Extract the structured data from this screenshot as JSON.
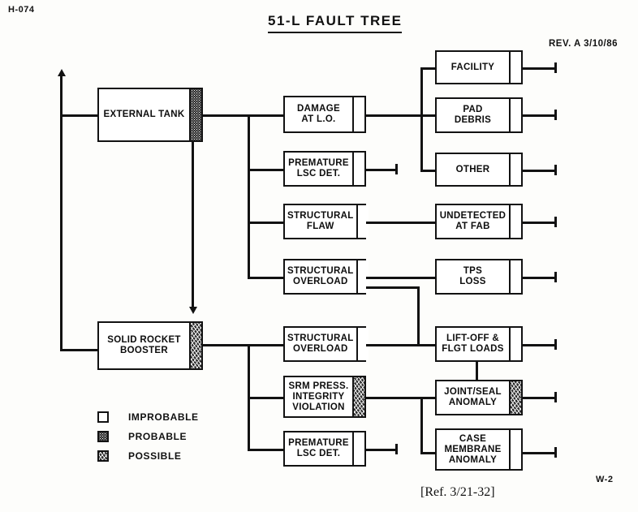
{
  "meta": {
    "doc_id": "H-074",
    "title": "51-L FAULT TREE",
    "revision": "REV. A 3/10/86",
    "sheet_id": "W-2",
    "reference": "[Ref. 3/21-32]"
  },
  "legend": {
    "items": [
      {
        "label": "IMPROBABLE",
        "fill": "improbable"
      },
      {
        "label": "PROBABLE",
        "fill": "probable"
      },
      {
        "label": "POSSIBLE",
        "fill": "possible"
      }
    ]
  },
  "nodes": [
    {
      "id": "external-tank",
      "label": "EXTERNAL TANK",
      "marker": "probable"
    },
    {
      "id": "solid-rocket-booster",
      "label": "SOLID ROCKET\nBOOSTER",
      "marker": "possible"
    },
    {
      "id": "damage-at-lo",
      "label": "DAMAGE\nAT L.O.",
      "marker": "improbable"
    },
    {
      "id": "premature-lsc-det-et",
      "label": "PREMATURE\nLSC DET.",
      "marker": "improbable"
    },
    {
      "id": "structural-flaw",
      "label": "STRUCTURAL\nFLAW",
      "marker": "improbable"
    },
    {
      "id": "structural-overload-et",
      "label": "STRUCTURAL\nOVERLOAD",
      "marker": "improbable"
    },
    {
      "id": "structural-overload-srb",
      "label": "STRUCTURAL\nOVERLOAD",
      "marker": "improbable"
    },
    {
      "id": "srm-press-integrity",
      "label": "SRM PRESS.\nINTEGRITY\nVIOLATION",
      "marker": "possible"
    },
    {
      "id": "premature-lsc-det-srb",
      "label": "PREMATURE\nLSC DET.",
      "marker": "improbable"
    },
    {
      "id": "facility",
      "label": "FACILITY",
      "marker": "improbable"
    },
    {
      "id": "pad-debris",
      "label": "PAD\nDEBRIS",
      "marker": "improbable"
    },
    {
      "id": "other",
      "label": "OTHER",
      "marker": "improbable"
    },
    {
      "id": "undetected-at-fab",
      "label": "UNDETECTED\nAT FAB",
      "marker": "improbable"
    },
    {
      "id": "tps-loss",
      "label": "TPS\nLOSS",
      "marker": "improbable"
    },
    {
      "id": "lift-off-flgt-loads",
      "label": "LIFT-OFF &\nFLGT LOADS",
      "marker": "improbable"
    },
    {
      "id": "joint-seal-anomaly",
      "label": "JOINT/SEAL\nANOMALY",
      "marker": "possible"
    },
    {
      "id": "case-membrane-anomaly",
      "label": "CASE\nMEMBRANE\nANOMALY",
      "marker": "improbable"
    }
  ],
  "colors": {
    "ink": "#121212",
    "paper": "#fdfdfb"
  }
}
